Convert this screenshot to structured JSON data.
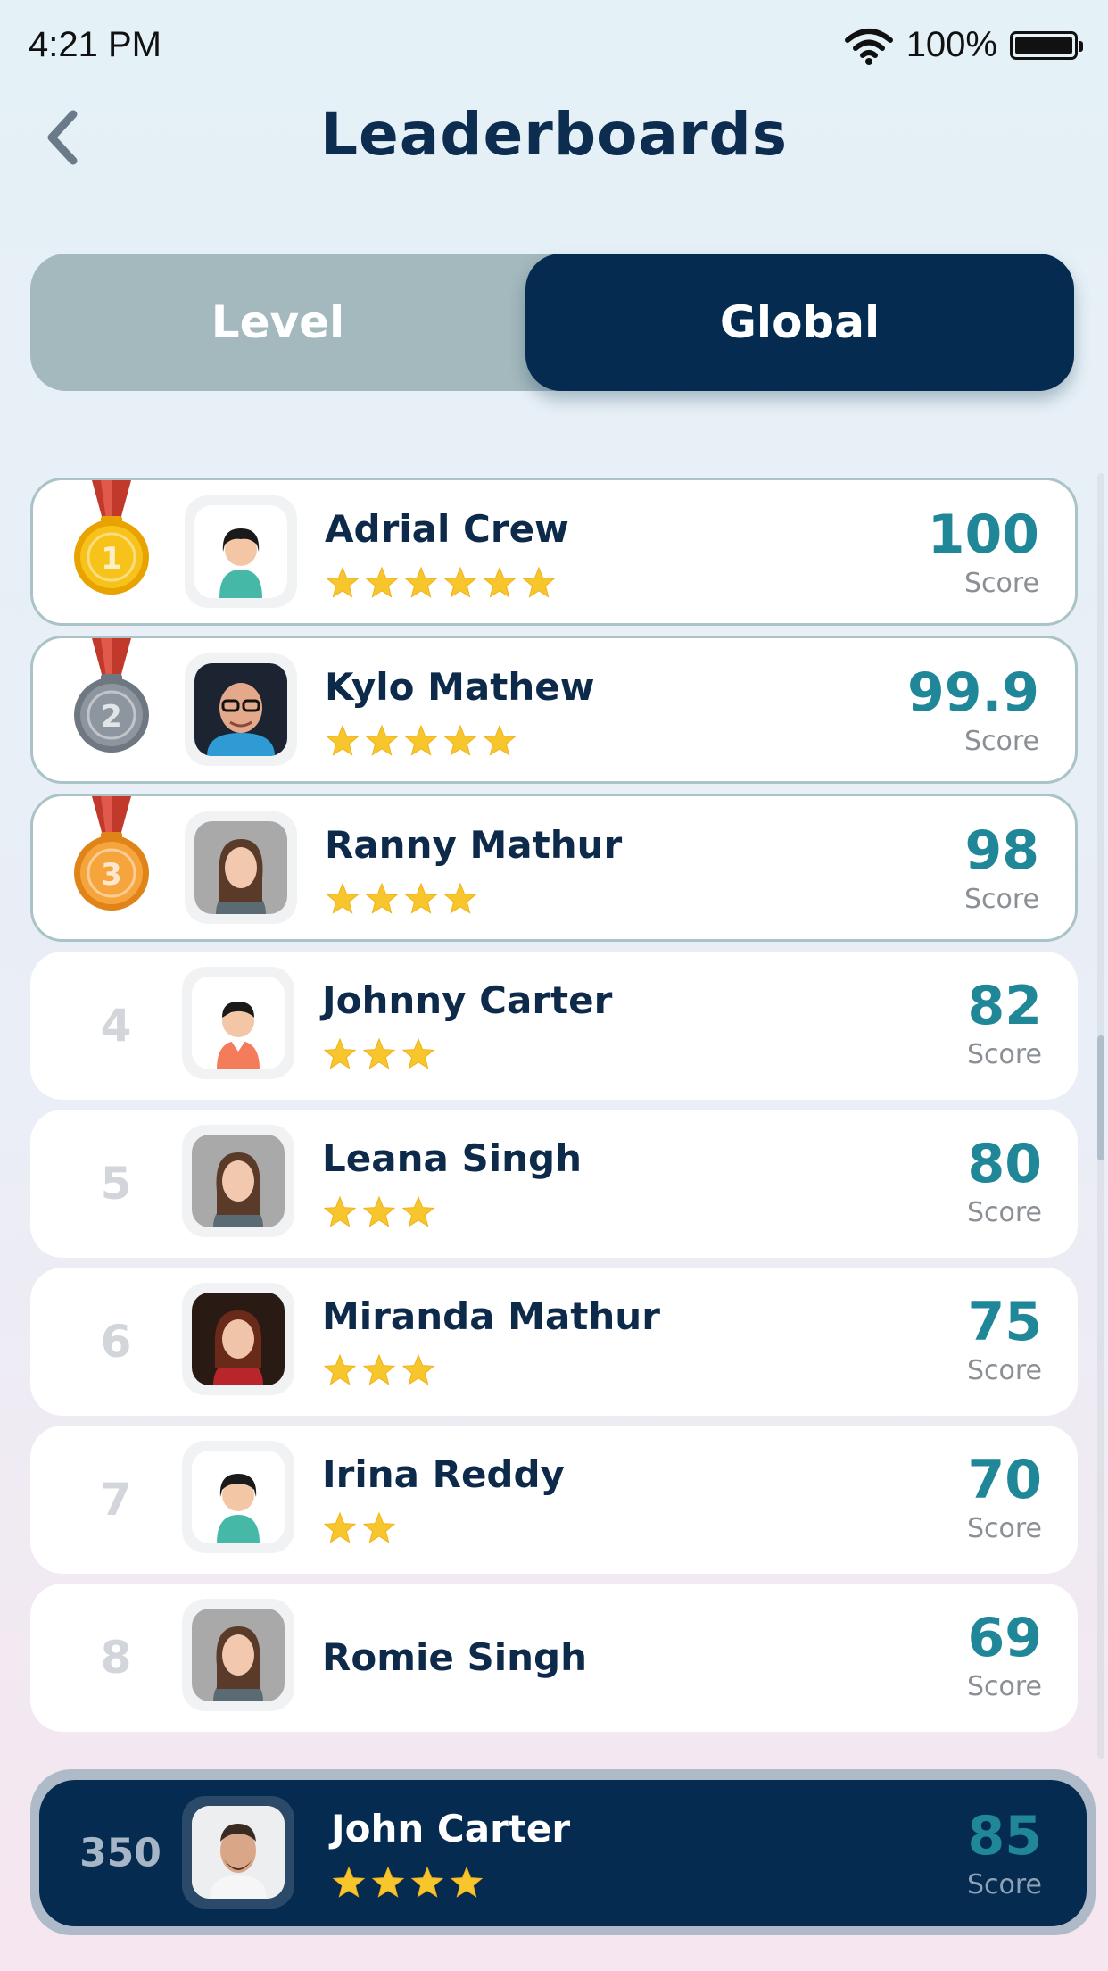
{
  "status_bar": {
    "time": "4:21 PM",
    "battery": "100%",
    "battery_level": 1.0
  },
  "header": {
    "title": "Leaderboards",
    "back_icon": "chevron-left-icon"
  },
  "tabs": [
    {
      "label": "Level",
      "selected": false
    },
    {
      "label": "Global",
      "selected": true
    }
  ],
  "score_label": "Score",
  "colors": {
    "navy": "#062b50",
    "teal": "#1f8797",
    "star": "#f7c52c",
    "gold": "#f5b800",
    "silver": "#8a939c",
    "bronze": "#f29a2e"
  },
  "leaderboard": [
    {
      "rank": "1",
      "medal": "gold",
      "name": "Adrial Crew",
      "stars": 6,
      "score": "100",
      "avatar": "avatar-placeholder-female"
    },
    {
      "rank": "2",
      "medal": "silver",
      "name": "Kylo Mathew",
      "stars": 5,
      "score": "99.9",
      "avatar": "avatar-photo-man-glasses"
    },
    {
      "rank": "3",
      "medal": "bronze",
      "name": "Ranny Mathur",
      "stars": 4,
      "score": "98",
      "avatar": "avatar-photo-woman"
    },
    {
      "rank": "4",
      "medal": null,
      "name": "Johnny Carter",
      "stars": 3,
      "score": "82",
      "avatar": "avatar-placeholder-male"
    },
    {
      "rank": "5",
      "medal": null,
      "name": "Leana Singh",
      "stars": 3,
      "score": "80",
      "avatar": "avatar-photo-woman"
    },
    {
      "rank": "6",
      "medal": null,
      "name": "Miranda Mathur",
      "stars": 3,
      "score": "75",
      "avatar": "avatar-photo-woman-red"
    },
    {
      "rank": "7",
      "medal": null,
      "name": "Irina Reddy",
      "stars": 2,
      "score": "70",
      "avatar": "avatar-placeholder-female"
    },
    {
      "rank": "8",
      "medal": null,
      "name": "Romie Singh",
      "stars": 0,
      "score": "69",
      "avatar": "avatar-photo-woman"
    }
  ],
  "current_user": {
    "rank": "350",
    "name": "John Carter",
    "stars": 4,
    "score": "85",
    "avatar": "avatar-photo-man"
  }
}
